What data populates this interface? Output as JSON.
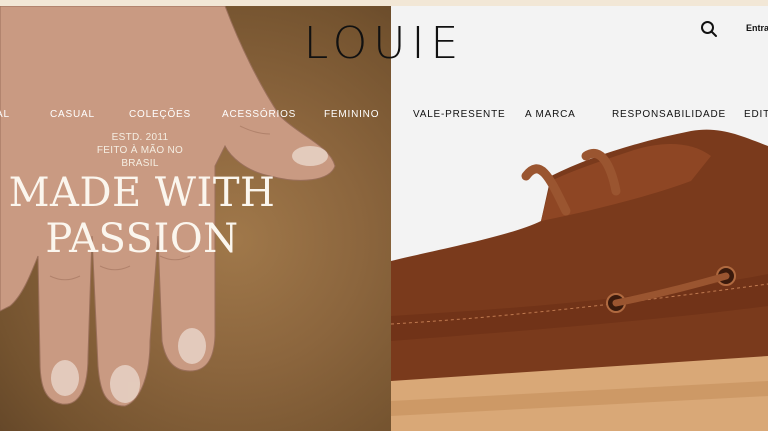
{
  "brand": {
    "logo": "LOUIE"
  },
  "header": {
    "login_label": "Entrar",
    "search_icon": "search-icon"
  },
  "nav": {
    "items": [
      {
        "label": "AL"
      },
      {
        "label": "CASUAL"
      },
      {
        "label": "COLEÇÕES"
      },
      {
        "label": "ACESSÓRIOS"
      },
      {
        "label": "FEMININO"
      },
      {
        "label": "VALE-PRESENTE"
      },
      {
        "label": "A MARCA"
      },
      {
        "label": "RESPONSABILIDADE"
      },
      {
        "label": "EDITO"
      }
    ]
  },
  "hero": {
    "estd": "ESTD. 2011",
    "made_in": "FEITO À MÃO NO BRASIL",
    "headline_1": "MADE WITH",
    "headline_2": "PASSION",
    "left_image": "hand-on-leather-photo",
    "right_image": "brown-leather-boat-shoe-photo"
  },
  "colors": {
    "accent_top": "#f2e7d6",
    "leather": "#8b653d",
    "shoe": "#7a3a1c",
    "sole": "#d9a877"
  }
}
